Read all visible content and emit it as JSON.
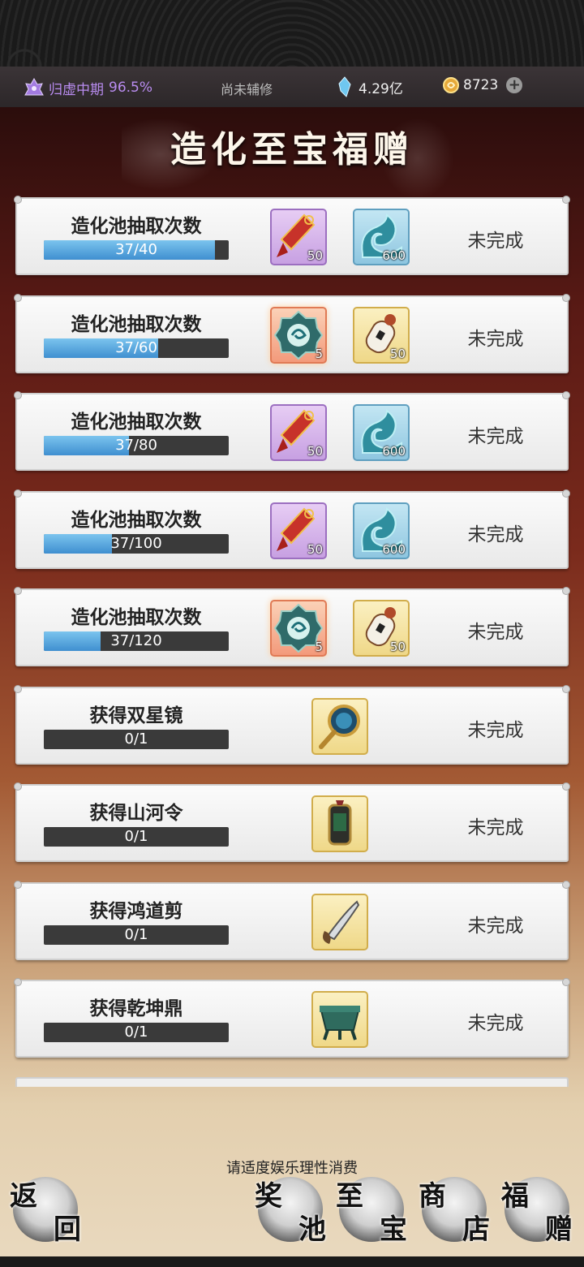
{
  "status_bar": {
    "realm": "归虚中期",
    "realm_progress": "96.5%",
    "assist": "尚未辅修",
    "spirit_stones": "4.29亿",
    "gold": "8723"
  },
  "title": "造化至宝福赠",
  "tasks": [
    {
      "label": "造化池抽取次数",
      "progress_text": "37/40",
      "progress": 0.925,
      "status": "未完成",
      "rewards": [
        {
          "icon": "red-talisman-icon",
          "qty": "50"
        },
        {
          "icon": "water-wave-icon",
          "qty": "600"
        }
      ]
    },
    {
      "label": "造化池抽取次数",
      "progress_text": "37/60",
      "progress": 0.617,
      "status": "未完成",
      "rewards": [
        {
          "icon": "spirit-orb-icon",
          "qty": "5"
        },
        {
          "icon": "gourd-scroll-icon",
          "qty": "50"
        }
      ]
    },
    {
      "label": "造化池抽取次数",
      "progress_text": "37/80",
      "progress": 0.4625,
      "status": "未完成",
      "rewards": [
        {
          "icon": "red-talisman-icon",
          "qty": "50"
        },
        {
          "icon": "water-wave-icon",
          "qty": "600"
        }
      ]
    },
    {
      "label": "造化池抽取次数",
      "progress_text": "37/100",
      "progress": 0.37,
      "status": "未完成",
      "rewards": [
        {
          "icon": "red-talisman-icon",
          "qty": "50"
        },
        {
          "icon": "water-wave-icon",
          "qty": "600"
        }
      ]
    },
    {
      "label": "造化池抽取次数",
      "progress_text": "37/120",
      "progress": 0.308,
      "status": "未完成",
      "rewards": [
        {
          "icon": "spirit-orb-icon",
          "qty": "5"
        },
        {
          "icon": "gourd-scroll-icon",
          "qty": "50"
        }
      ]
    },
    {
      "label": "获得双星镜",
      "progress_text": "0/1",
      "progress": 0,
      "status": "未完成",
      "rewards": [
        {
          "icon": "mirror-icon",
          "qty": ""
        }
      ]
    },
    {
      "label": "获得山河令",
      "progress_text": "0/1",
      "progress": 0,
      "status": "未完成",
      "rewards": [
        {
          "icon": "lantern-token-icon",
          "qty": ""
        }
      ]
    },
    {
      "label": "获得鸿道剪",
      "progress_text": "0/1",
      "progress": 0,
      "status": "未完成",
      "rewards": [
        {
          "icon": "scissors-blade-icon",
          "qty": ""
        }
      ]
    },
    {
      "label": "获得乾坤鼎",
      "progress_text": "0/1",
      "progress": 0,
      "status": "未完成",
      "rewards": [
        {
          "icon": "cauldron-icon",
          "qty": ""
        }
      ]
    }
  ],
  "notice": "请适度娱乐理性消费",
  "nav": {
    "back": [
      "返",
      "回"
    ],
    "pool": [
      "奖",
      "池"
    ],
    "treasure": [
      "至",
      "宝"
    ],
    "shop": [
      "商",
      "店"
    ],
    "gift": [
      "福",
      "赠"
    ]
  },
  "colors": {
    "progress_fill": "#5aa8e0",
    "realm_purple": "#b98cf0"
  }
}
